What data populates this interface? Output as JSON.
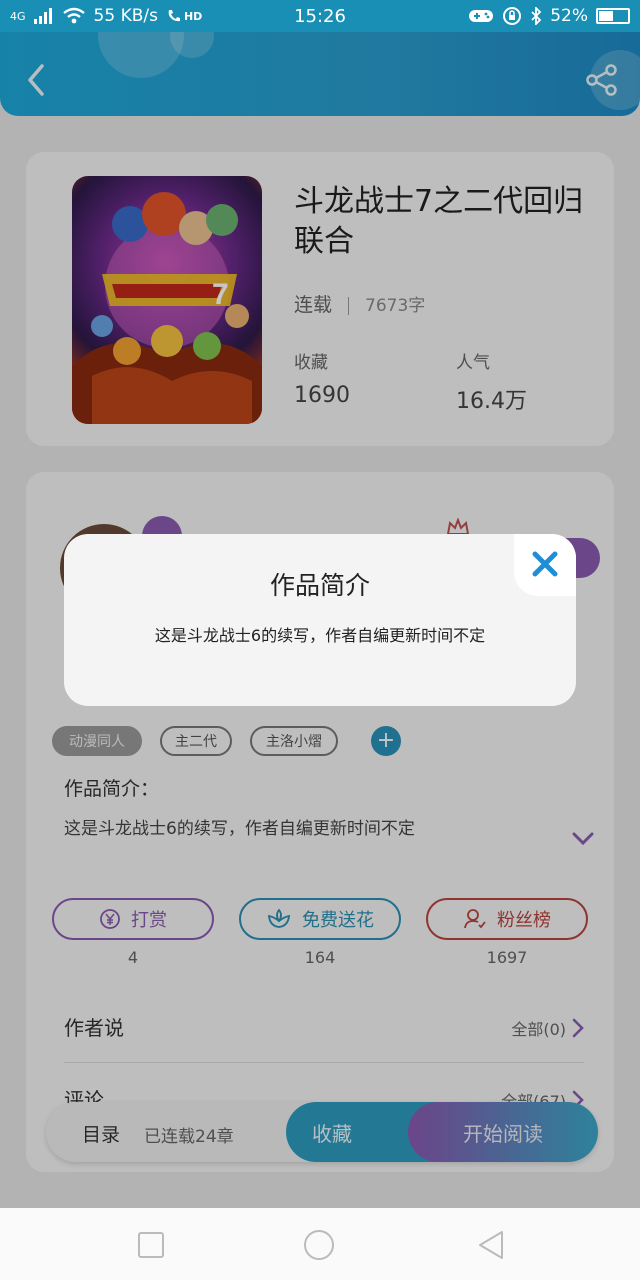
{
  "status_bar": {
    "network": "4G",
    "speed": "55 KB/s",
    "hd": "HD",
    "time": "15:26",
    "battery": "52%",
    "battery_level": 0.52
  },
  "header": {
    "back_icon": "chevron-left-icon",
    "share_icon": "share-icon"
  },
  "book": {
    "title": "斗龙战士7之二代回归联合",
    "status": "连载",
    "word_count": "7673字",
    "stats": [
      {
        "label": "收藏",
        "value": "1690"
      },
      {
        "label": "人气",
        "value": "16.4万"
      }
    ]
  },
  "tags": [
    "动漫同人",
    "主二代",
    "主洛小熠"
  ],
  "intro": {
    "label": "作品简介：",
    "text": "这是斗龙战士6的续写，作者自编更新时间不定"
  },
  "actions": [
    {
      "label": "打赏",
      "count": "4",
      "icon": "yen-icon",
      "color": "#8a5ab0"
    },
    {
      "label": "免费送花",
      "count": "164",
      "icon": "flower-icon",
      "color": "#2a8fb2"
    },
    {
      "label": "粉丝榜",
      "count": "1697",
      "icon": "user-rank-icon",
      "color": "#b8433e"
    }
  ],
  "author_say": {
    "label": "作者说",
    "right": "全部(0)"
  },
  "comments": {
    "label": "评论",
    "right": "全部(67)"
  },
  "bottom_bar": {
    "toc": "目录",
    "serial": "已连载24章",
    "collect": "收藏",
    "read": "开始阅读"
  },
  "modal": {
    "title": "作品简介",
    "text": "这是斗龙战士6的续写，作者自编更新时间不定",
    "close_icon": "close-icon"
  },
  "colors": {
    "accent_blue": "#1ea7d8",
    "accent_purple": "#8a59b0",
    "close_blue": "#1e8fd6"
  }
}
